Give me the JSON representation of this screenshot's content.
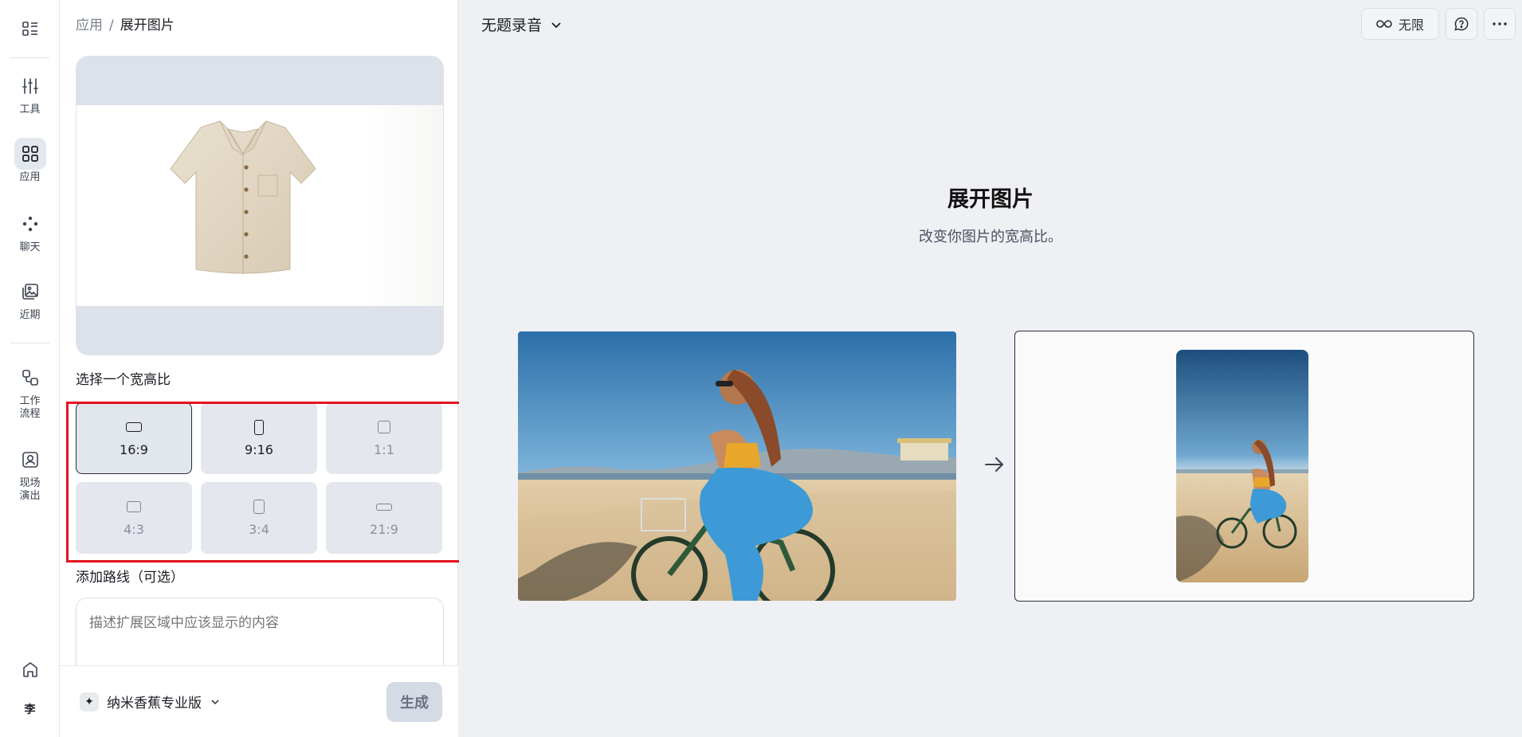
{
  "rail": {
    "items": [
      {
        "label": "工具"
      },
      {
        "label": "应用"
      },
      {
        "label": "聊天"
      },
      {
        "label": "近期"
      },
      {
        "label": "工作\n流程"
      },
      {
        "label": "现场\n演出"
      }
    ],
    "avatar": "李"
  },
  "panel": {
    "breadcrumb": {
      "parent": "应用",
      "separator": "/",
      "current": "展开图片"
    },
    "ratio_label": "选择一个宽高比",
    "ratios": [
      {
        "label": "16:9",
        "selected": true
      },
      {
        "label": "9:16",
        "selected": false
      },
      {
        "label": "1:1",
        "selected": false
      },
      {
        "label": "4:3",
        "selected": false
      },
      {
        "label": "3:4",
        "selected": false
      },
      {
        "label": "21:9",
        "selected": false
      }
    ],
    "prompt_label": "添加路线（可选）",
    "prompt_placeholder": "描述扩展区域中应该显示的内容",
    "model_name": "纳米香蕉专业版",
    "model_badge": "✦",
    "generate": "生成"
  },
  "main": {
    "session_title": "无题录音",
    "plan_label": "无限",
    "heading": "展开图片",
    "subheading": "改变你图片的宽高比。"
  },
  "colors": {
    "highlight": "#e3141e",
    "selected_border": "#2a2e36",
    "panel_bg": "#ffffff",
    "main_bg": "#eef0f4"
  }
}
